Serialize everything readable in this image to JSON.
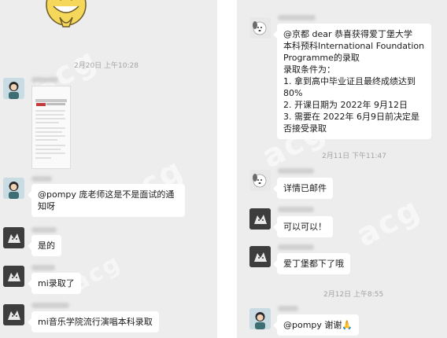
{
  "left_chat": {
    "timestamp": "2月20日 上午10:28",
    "messages": [
      {
        "text": "@pompy 庞老师这是不是面试的通知呀",
        "lines": [
          "@pompy 庞老师这是不是面试的通",
          "知呀"
        ]
      },
      {
        "text": "是的"
      },
      {
        "text": "mi录取了"
      },
      {
        "text": "mi音乐学院流行演唱本科录取"
      }
    ]
  },
  "right_chat": {
    "top_message": {
      "lines": [
        "@京都 dear 恭喜获得爱丁堡大学",
        "本科预科International Foundation",
        "Programme的录取",
        "录取条件为：",
        "1. 拿到高中毕业证且最终成绩达到",
        "80%",
        "2. 开课日期为 2022年 9月12日",
        "3. 需要在 2022年 6月9日前决定是",
        "否接受录取"
      ]
    },
    "timestamp_1": "2月11日 下午11:47",
    "msg_1": "详情已邮件",
    "msg_2": "可以可以！",
    "msg_3": "爱丁堡都下了哦",
    "timestamp_2": "2月12日 上午8:55",
    "msg_4": "@pompy 谢谢🙏"
  },
  "watermark_text": "acg",
  "colors": {
    "chat_bg": "#ededed",
    "bubble": "#ffffff",
    "time_text": "#a3a3a3"
  }
}
